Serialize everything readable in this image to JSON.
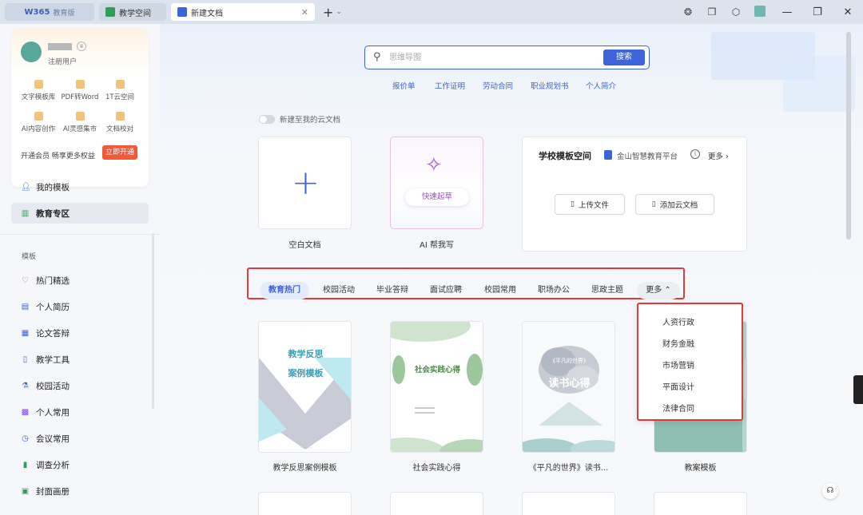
{
  "titlebar": {
    "app_logo": "W365",
    "app_sub": "教育版",
    "tab_space": "教学空间",
    "tab_doc": "新建文档",
    "new_tab": "+",
    "new_tab_arrow": "⌄"
  },
  "sidebar": {
    "user_role": "注册用户",
    "features": [
      {
        "label": "文字模板库"
      },
      {
        "label": "PDF转Word"
      },
      {
        "label": "1T云空间"
      },
      {
        "label": "AI内容创作"
      },
      {
        "label": "AI灵感集市"
      },
      {
        "label": "文档校对"
      }
    ],
    "vip_promo": "开通会员 畅享更多权益",
    "vip_button": "立即开通",
    "items_top": [
      {
        "label": "我的模板",
        "icon": "user-icon"
      },
      {
        "label": "教育专区",
        "icon": "education-icon"
      }
    ],
    "section": "模板",
    "items": [
      {
        "label": "热门精选",
        "icon": "heart-icon"
      },
      {
        "label": "个人简历",
        "icon": "resume-icon"
      },
      {
        "label": "论文答辩",
        "icon": "paper-icon"
      },
      {
        "label": "教学工具",
        "icon": "book-icon"
      },
      {
        "label": "校园活动",
        "icon": "flask-icon"
      },
      {
        "label": "个人常用",
        "icon": "grid-icon"
      },
      {
        "label": "会议常用",
        "icon": "meeting-icon"
      },
      {
        "label": "调查分析",
        "icon": "chart-icon"
      },
      {
        "label": "封面画册",
        "icon": "image-icon"
      }
    ]
  },
  "search": {
    "placeholder": "思维导图",
    "button": "搜索",
    "quick": [
      "报价单",
      "工作证明",
      "劳动合同",
      "职业规划书",
      "个人简介"
    ]
  },
  "toggle_label": "新建至我的云文档",
  "create_cards": {
    "blank": "空白文档",
    "ai_button": "快速起草",
    "ai_label": "AI 帮我写"
  },
  "school": {
    "title": "学校模板空间",
    "platform": "金山智慧教育平台",
    "info": "i",
    "more": "更多 ›",
    "upload": "上传文件",
    "add_cloud": "添加云文档"
  },
  "categories": [
    "教育热门",
    "校园活动",
    "毕业答辩",
    "面试应聘",
    "校园常用",
    "职场办公",
    "思政主题",
    "更多 ⌃"
  ],
  "dropdown": [
    "人资行政",
    "财务金融",
    "市场营销",
    "平面设计",
    "法律合同"
  ],
  "templates": [
    {
      "label": "教学反思案例模板",
      "cover_line1": "教学反思",
      "cover_line2": "案例模板"
    },
    {
      "label": "社会实践心得",
      "cover_title": "社会实践心得"
    },
    {
      "label": "《平凡的世界》读书...",
      "cover_title": "读书心得",
      "cover_sub": "《平凡的世界》"
    },
    {
      "label": "教案模板"
    }
  ],
  "colors": {
    "accent": "#3d64d8",
    "highlight": "#e03a3a",
    "vip": "#f05a3a"
  }
}
